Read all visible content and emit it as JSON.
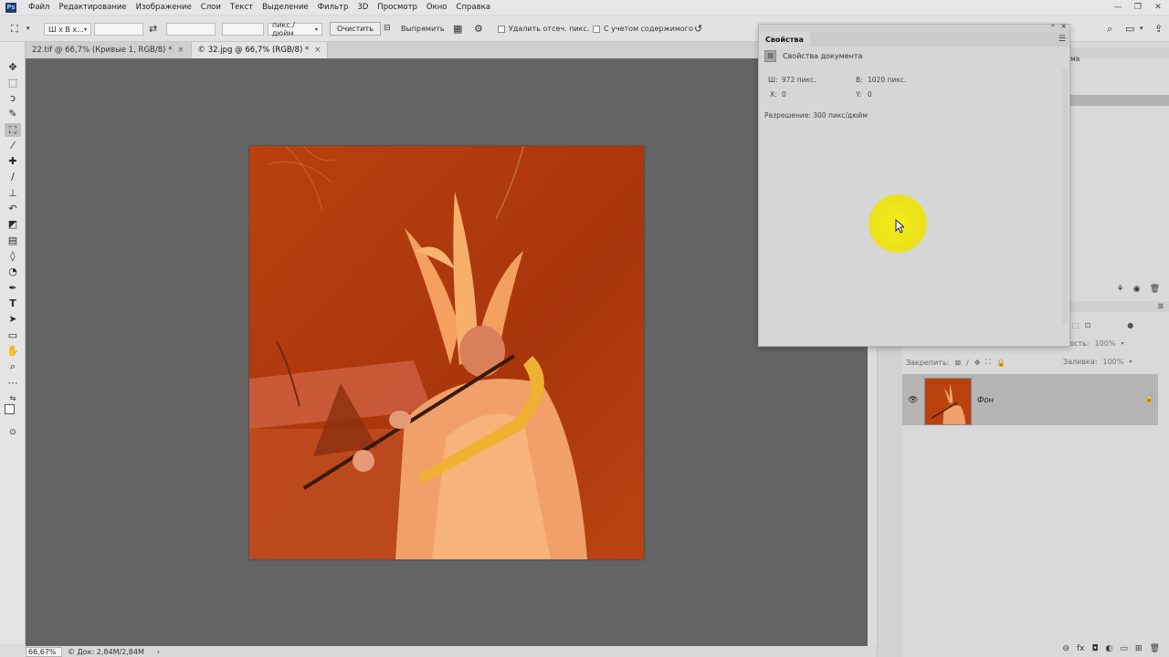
{
  "app": {
    "logo": "Ps"
  },
  "menu": [
    "Файл",
    "Редактирование",
    "Изображение",
    "Слои",
    "Текст",
    "Выделение",
    "Фильтр",
    "3D",
    "Просмотр",
    "Окно",
    "Справка"
  ],
  "options": {
    "ratio_select": "Ш x В x...",
    "width_value": "",
    "height_value": "",
    "resolution_value": "",
    "units_select": "пикс./дюйм",
    "clear_label": "Очистить",
    "straighten_label": "Выпрямить",
    "delete_cropped_label": "Удалить отсеч. пикс.",
    "content_aware_label": "С учетом содержимого"
  },
  "tabs": [
    {
      "label": "22.tif @ 66,7% (Кривые 1, RGB/8) *",
      "active": false
    },
    {
      "label": "© 32.jpg @ 66,7% (RGB/8) *",
      "active": true
    }
  ],
  "status": {
    "zoom": "66,67%",
    "doc": "© Док: 2,84M/2,84M"
  },
  "properties": {
    "title": "Свойства",
    "subtitle": "Свойства документа",
    "w_label": "Ш:",
    "w_value": "972 пикс.",
    "h_label": "В:",
    "h_value": "1020 пикс.",
    "x_label": "X:",
    "x_value": "0",
    "y_label": "Y:",
    "y_value": "0",
    "resolution": "Разрешение: 300 пикс/дюйм"
  },
  "layers": {
    "lock_label": "Закрепить:",
    "opacity_label": "ность:",
    "opacity_value": "100%",
    "fill_label": "Заливка:",
    "fill_value": "100%",
    "layer_name": "Фон",
    "side_label": "ма"
  },
  "colors": {
    "accent": "#e6e6e6",
    "photo_bg": "#b8410e",
    "highlight": "#ece21a"
  }
}
